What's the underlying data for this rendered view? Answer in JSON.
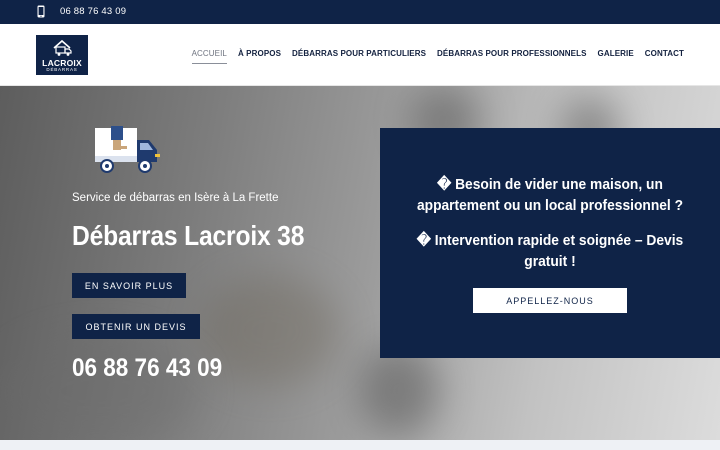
{
  "topbar": {
    "phone": "06 88 76 43 09",
    "icon": "mobile-phone-icon"
  },
  "logo": {
    "name": "LACROIX",
    "sub": "DÉBARRAS",
    "icon": "house-truck-icon"
  },
  "nav": {
    "items": [
      {
        "label": "ACCUEIL",
        "active": true
      },
      {
        "label": "À PROPOS"
      },
      {
        "label": "DÉBARRAS POUR PARTICULIERS"
      },
      {
        "label": "DÉBARRAS POUR PROFESSIONNELS"
      },
      {
        "label": "GALERIE"
      },
      {
        "label": "CONTACT"
      }
    ]
  },
  "hero": {
    "icon": "delivery-truck-icon",
    "subtitle": "Service de débarras en Isère à La Frette",
    "title": "Débarras Lacroix 38",
    "button1": "EN SAVOIR PLUS",
    "button2": "OBTENIR UN DEVIS",
    "phone": "06 88 76 43 09"
  },
  "cta": {
    "line1": "� Besoin de vider une maison, un appartement ou un local professionnel ?",
    "line2": "� Intervention rapide et soignée – Devis gratuit !",
    "button": "APPELLEZ-NOUS"
  },
  "colors": {
    "navy": "#0f2347",
    "white": "#ffffff",
    "truck_box": "#c9a57a"
  }
}
